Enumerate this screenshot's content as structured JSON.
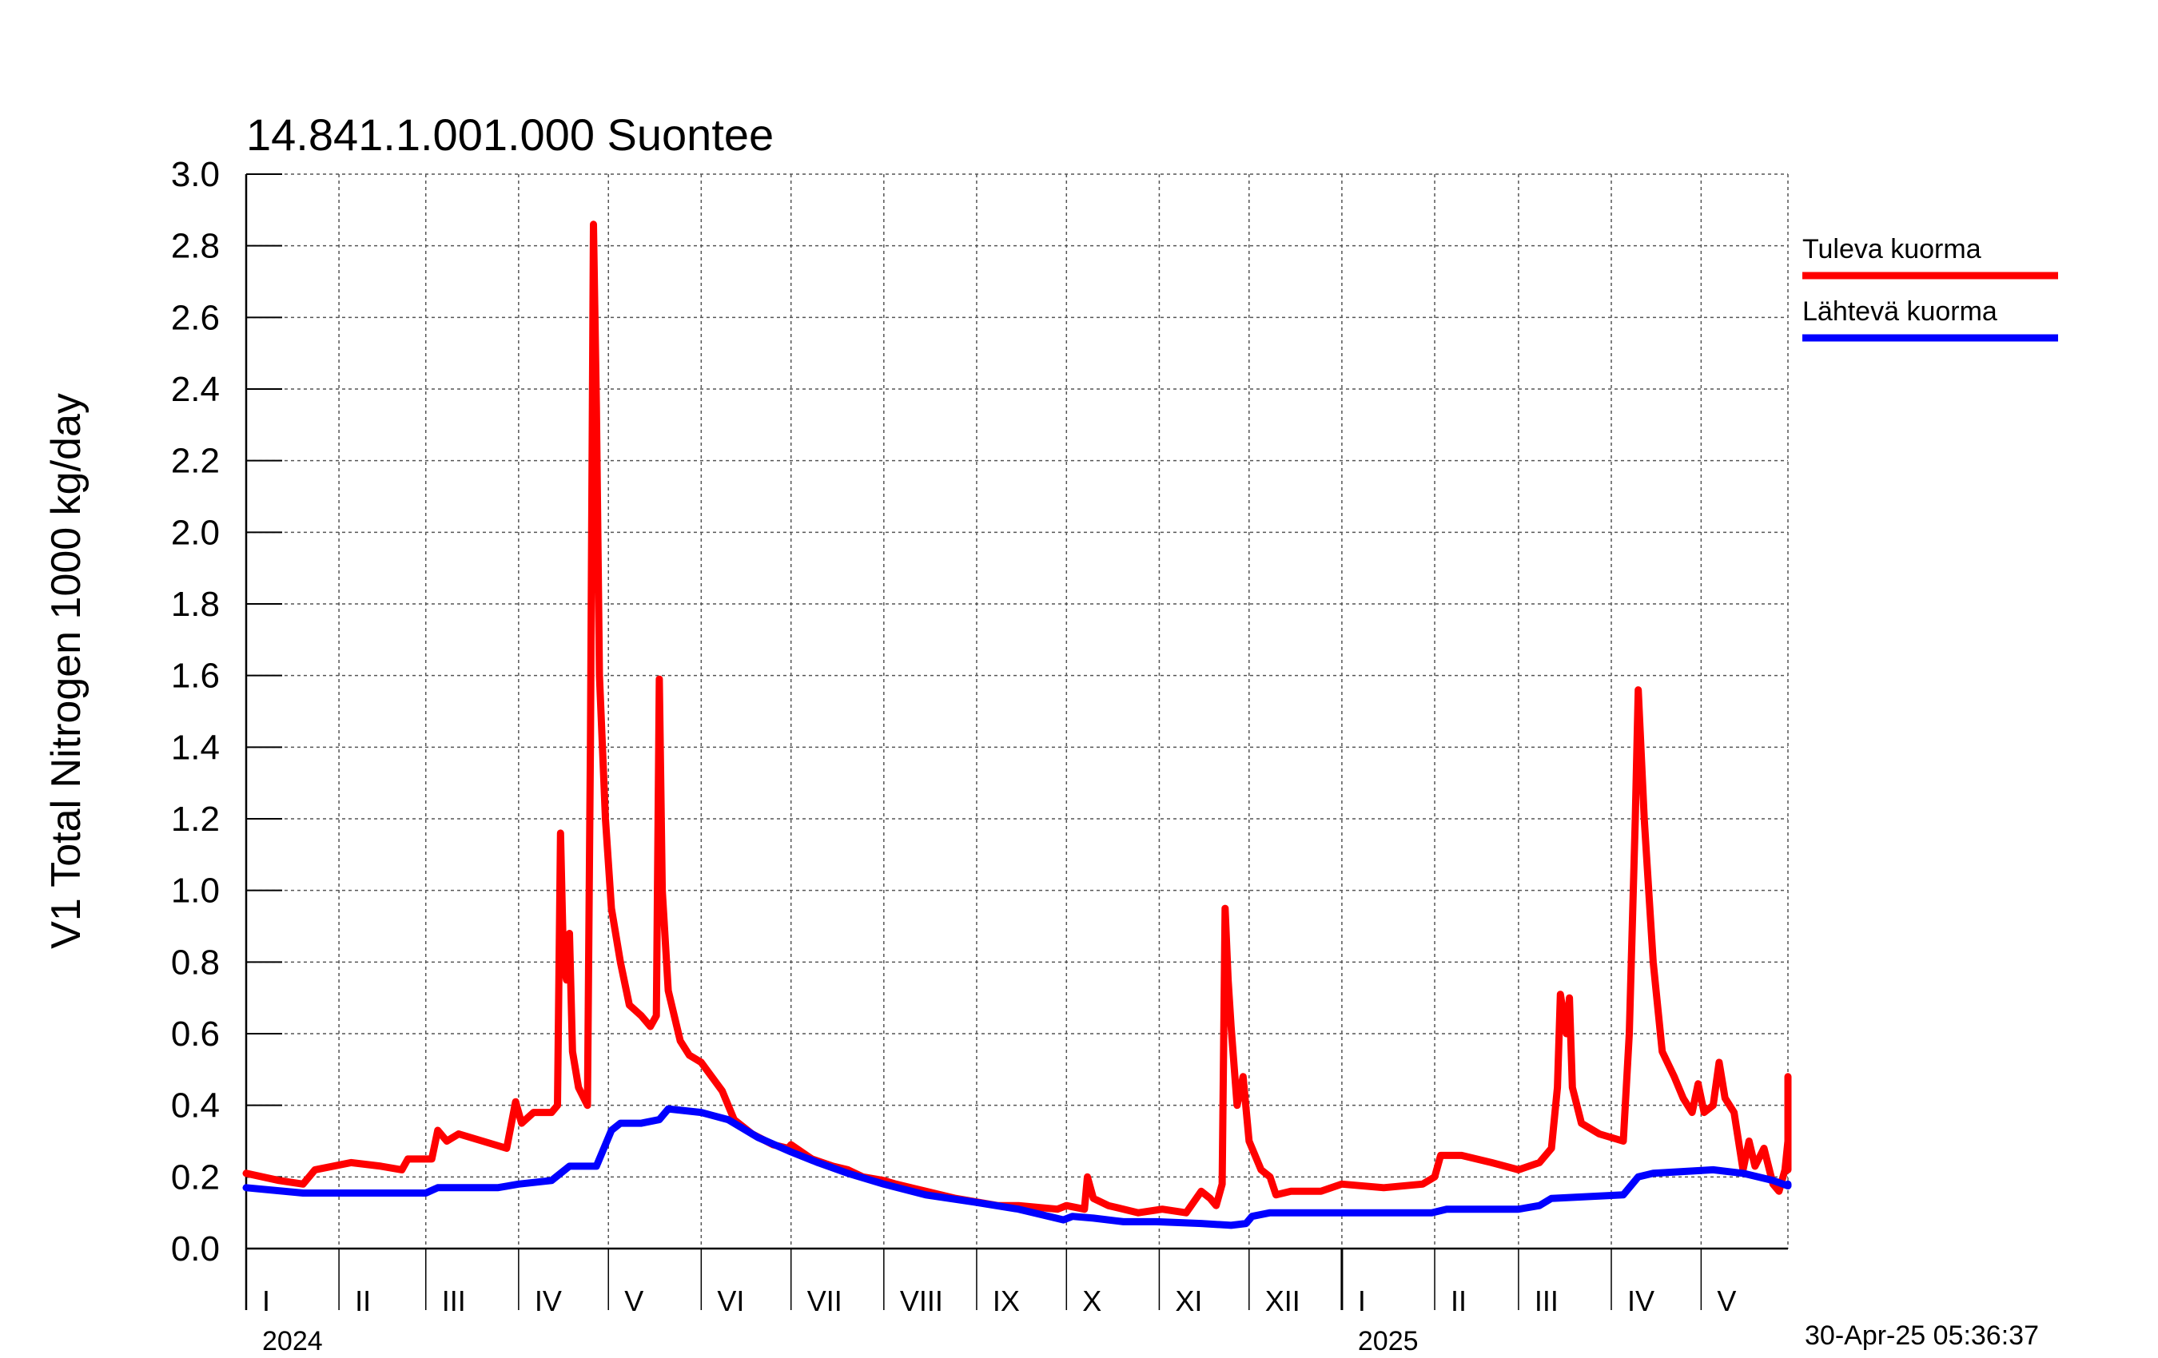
{
  "chart_data": {
    "type": "line",
    "title": "14.841.1.001.000 Suontee",
    "ylabel": "V1 Total Nitrogen 1000 kg/day",
    "ylim": [
      0,
      3.0
    ],
    "yticks": [
      "0.0",
      "0.2",
      "0.4",
      "0.6",
      "0.8",
      "1.0",
      "1.2",
      "1.4",
      "1.6",
      "1.8",
      "2.0",
      "2.2",
      "2.4",
      "2.6",
      "2.8",
      "3.0"
    ],
    "x_start": "2024-01-01",
    "x_end": "2025-05-30",
    "month_labels": [
      "I",
      "II",
      "III",
      "IV",
      "V",
      "VI",
      "VII",
      "VIII",
      "IX",
      "X",
      "XI",
      "XII",
      "I",
      "II",
      "III",
      "IV",
      "V"
    ],
    "year_labels": [
      {
        "label": "2024",
        "date": "2024-01-01"
      },
      {
        "label": "2025",
        "date": "2025-01-01"
      }
    ],
    "timestamp": "30-Apr-25 05:36:37",
    "legend_position": "right",
    "grid": true,
    "series": [
      {
        "name": "Tuleva kuorma",
        "color": "#ff0000",
        "points": [
          [
            "2024-01-01",
            0.21
          ],
          [
            "2024-01-12",
            0.19
          ],
          [
            "2024-01-20",
            0.18
          ],
          [
            "2024-01-24",
            0.22
          ],
          [
            "2024-02-05",
            0.24
          ],
          [
            "2024-02-15",
            0.23
          ],
          [
            "2024-02-22",
            0.22
          ],
          [
            "2024-02-24",
            0.25
          ],
          [
            "2024-03-03",
            0.25
          ],
          [
            "2024-03-05",
            0.33
          ],
          [
            "2024-03-08",
            0.3
          ],
          [
            "2024-03-12",
            0.32
          ],
          [
            "2024-03-20",
            0.3
          ],
          [
            "2024-03-28",
            0.28
          ],
          [
            "2024-03-31",
            0.41
          ],
          [
            "2024-04-02",
            0.35
          ],
          [
            "2024-04-06",
            0.38
          ],
          [
            "2024-04-12",
            0.38
          ],
          [
            "2024-04-14",
            0.4
          ],
          [
            "2024-04-15",
            1.16
          ],
          [
            "2024-04-16",
            0.8
          ],
          [
            "2024-04-17",
            0.75
          ],
          [
            "2024-04-18",
            0.88
          ],
          [
            "2024-04-19",
            0.55
          ],
          [
            "2024-04-21",
            0.45
          ],
          [
            "2024-04-24",
            0.4
          ],
          [
            "2024-04-25",
            1.4
          ],
          [
            "2024-04-26",
            2.86
          ],
          [
            "2024-04-27",
            2.35
          ],
          [
            "2024-04-28",
            1.6
          ],
          [
            "2024-04-30",
            1.2
          ],
          [
            "2024-05-02",
            0.95
          ],
          [
            "2024-05-05",
            0.8
          ],
          [
            "2024-05-08",
            0.68
          ],
          [
            "2024-05-12",
            0.65
          ],
          [
            "2024-05-15",
            0.62
          ],
          [
            "2024-05-17",
            0.65
          ],
          [
            "2024-05-18",
            1.59
          ],
          [
            "2024-05-19",
            1.0
          ],
          [
            "2024-05-21",
            0.72
          ],
          [
            "2024-05-25",
            0.58
          ],
          [
            "2024-05-28",
            0.54
          ],
          [
            "2024-06-01",
            0.52
          ],
          [
            "2024-06-08",
            0.44
          ],
          [
            "2024-06-12",
            0.36
          ],
          [
            "2024-06-18",
            0.32
          ],
          [
            "2024-06-25",
            0.29
          ],
          [
            "2024-06-30",
            0.28
          ],
          [
            "2024-07-01",
            0.29
          ],
          [
            "2024-07-08",
            0.25
          ],
          [
            "2024-07-15",
            0.23
          ],
          [
            "2024-07-20",
            0.22
          ],
          [
            "2024-07-25",
            0.2
          ],
          [
            "2024-08-01",
            0.19
          ],
          [
            "2024-08-05",
            0.18
          ],
          [
            "2024-08-10",
            0.17
          ],
          [
            "2024-08-15",
            0.16
          ],
          [
            "2024-08-20",
            0.15
          ],
          [
            "2024-08-25",
            0.14
          ],
          [
            "2024-09-01",
            0.13
          ],
          [
            "2024-09-08",
            0.12
          ],
          [
            "2024-09-15",
            0.12
          ],
          [
            "2024-09-28",
            0.11
          ],
          [
            "2024-10-01",
            0.12
          ],
          [
            "2024-10-07",
            0.11
          ],
          [
            "2024-10-08",
            0.2
          ],
          [
            "2024-10-10",
            0.14
          ],
          [
            "2024-10-15",
            0.12
          ],
          [
            "2024-10-25",
            0.1
          ],
          [
            "2024-11-02",
            0.11
          ],
          [
            "2024-11-10",
            0.1
          ],
          [
            "2024-11-15",
            0.16
          ],
          [
            "2024-11-18",
            0.14
          ],
          [
            "2024-11-20",
            0.12
          ],
          [
            "2024-11-22",
            0.18
          ],
          [
            "2024-11-23",
            0.95
          ],
          [
            "2024-11-24",
            0.75
          ],
          [
            "2024-11-25",
            0.62
          ],
          [
            "2024-11-27",
            0.4
          ],
          [
            "2024-11-29",
            0.48
          ],
          [
            "2024-12-01",
            0.3
          ],
          [
            "2024-12-05",
            0.22
          ],
          [
            "2024-12-08",
            0.2
          ],
          [
            "2024-12-10",
            0.15
          ],
          [
            "2024-12-15",
            0.16
          ],
          [
            "2024-12-25",
            0.16
          ],
          [
            "2025-01-01",
            0.18
          ],
          [
            "2025-01-15",
            0.17
          ],
          [
            "2025-01-28",
            0.18
          ],
          [
            "2025-02-01",
            0.2
          ],
          [
            "2025-02-03",
            0.26
          ],
          [
            "2025-02-10",
            0.26
          ],
          [
            "2025-02-20",
            0.24
          ],
          [
            "2025-03-01",
            0.22
          ],
          [
            "2025-03-08",
            0.24
          ],
          [
            "2025-03-12",
            0.28
          ],
          [
            "2025-03-14",
            0.45
          ],
          [
            "2025-03-15",
            0.71
          ],
          [
            "2025-03-17",
            0.6
          ],
          [
            "2025-03-18",
            0.7
          ],
          [
            "2025-03-19",
            0.45
          ],
          [
            "2025-03-22",
            0.35
          ],
          [
            "2025-03-28",
            0.32
          ],
          [
            "2025-04-05",
            0.3
          ],
          [
            "2025-04-07",
            0.6
          ],
          [
            "2025-04-09",
            1.2
          ],
          [
            "2025-04-10",
            1.56
          ],
          [
            "2025-04-12",
            1.2
          ],
          [
            "2025-04-15",
            0.8
          ],
          [
            "2025-04-18",
            0.55
          ],
          [
            "2025-04-22",
            0.48
          ],
          [
            "2025-04-25",
            0.42
          ],
          [
            "2025-04-28",
            0.38
          ],
          [
            "2025-04-30",
            0.46
          ],
          [
            "2025-05-02",
            0.38
          ],
          [
            "2025-05-05",
            0.4
          ],
          [
            "2025-05-07",
            0.52
          ],
          [
            "2025-05-09",
            0.42
          ],
          [
            "2025-05-12",
            0.38
          ],
          [
            "2025-05-15",
            0.22
          ],
          [
            "2025-05-17",
            0.3
          ],
          [
            "2025-05-19",
            0.23
          ],
          [
            "2025-05-22",
            0.28
          ],
          [
            "2025-05-25",
            0.18
          ],
          [
            "2025-05-27",
            0.16
          ],
          [
            "2025-05-29",
            0.22
          ],
          [
            "2025-05-31",
            0.3
          ],
          [
            "2025-06-01",
            0.48
          ],
          [
            "2025-06-03",
            0.35
          ],
          [
            "2025-06-06",
            0.3
          ],
          [
            "2025-06-09",
            0.22
          ],
          [
            "2025-06-12",
            0.34
          ],
          [
            "2025-06-15",
            0.26
          ],
          [
            "2025-06-17",
            0.34
          ],
          [
            "2025-06-20",
            0.24
          ],
          [
            "2025-06-23",
            0.22
          ]
        ]
      },
      {
        "name": "Lähtevä kuorma",
        "color": "#0000ff",
        "points": [
          [
            "2024-01-01",
            0.17
          ],
          [
            "2024-01-20",
            0.155
          ],
          [
            "2024-02-10",
            0.155
          ],
          [
            "2024-03-01",
            0.155
          ],
          [
            "2024-03-05",
            0.17
          ],
          [
            "2024-03-25",
            0.17
          ],
          [
            "2024-04-01",
            0.18
          ],
          [
            "2024-04-12",
            0.19
          ],
          [
            "2024-04-18",
            0.23
          ],
          [
            "2024-04-27",
            0.23
          ],
          [
            "2024-05-02",
            0.33
          ],
          [
            "2024-05-05",
            0.35
          ],
          [
            "2024-05-12",
            0.35
          ],
          [
            "2024-05-18",
            0.36
          ],
          [
            "2024-05-21",
            0.39
          ],
          [
            "2024-06-01",
            0.38
          ],
          [
            "2024-06-10",
            0.36
          ],
          [
            "2024-06-20",
            0.31
          ],
          [
            "2024-07-01",
            0.27
          ],
          [
            "2024-07-10",
            0.24
          ],
          [
            "2024-07-20",
            0.21
          ],
          [
            "2024-08-01",
            0.18
          ],
          [
            "2024-08-15",
            0.15
          ],
          [
            "2024-08-31",
            0.13
          ],
          [
            "2024-09-15",
            0.11
          ],
          [
            "2024-09-30",
            0.08
          ],
          [
            "2024-10-03",
            0.09
          ],
          [
            "2024-10-10",
            0.085
          ],
          [
            "2024-10-20",
            0.075
          ],
          [
            "2024-10-31",
            0.075
          ],
          [
            "2024-11-15",
            0.07
          ],
          [
            "2024-11-25",
            0.065
          ],
          [
            "2024-11-30",
            0.07
          ],
          [
            "2024-12-02",
            0.09
          ],
          [
            "2024-12-08",
            0.1
          ],
          [
            "2024-12-31",
            0.1
          ],
          [
            "2025-01-31",
            0.1
          ],
          [
            "2025-02-05",
            0.11
          ],
          [
            "2025-03-01",
            0.11
          ],
          [
            "2025-03-08",
            0.12
          ],
          [
            "2025-03-12",
            0.14
          ],
          [
            "2025-04-05",
            0.15
          ],
          [
            "2025-04-10",
            0.2
          ],
          [
            "2025-04-15",
            0.21
          ],
          [
            "2025-05-05",
            0.22
          ],
          [
            "2025-05-15",
            0.21
          ],
          [
            "2025-05-25",
            0.19
          ],
          [
            "2025-05-31",
            0.175
          ],
          [
            "2025-06-10",
            0.18
          ],
          [
            "2025-06-23",
            0.175
          ]
        ]
      }
    ]
  }
}
